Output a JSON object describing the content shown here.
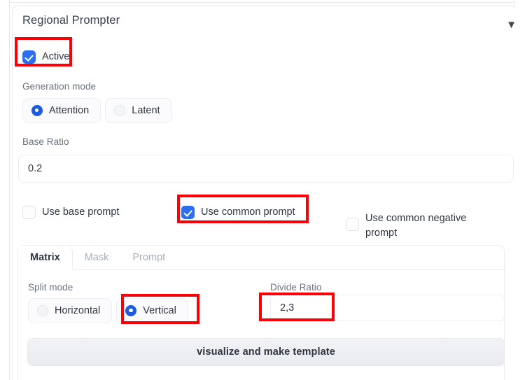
{
  "panel": {
    "title": "Regional Prompter",
    "collapse_icon": "chevron-down-icon",
    "collapse_glyph": "▼"
  },
  "active_checkbox": {
    "label": "Active",
    "checked": true
  },
  "generation_mode": {
    "label": "Generation mode",
    "options": [
      {
        "label": "Attention",
        "selected": true
      },
      {
        "label": "Latent",
        "selected": false
      }
    ]
  },
  "base_ratio": {
    "label": "Base Ratio",
    "value": "0.2",
    "placeholder": ""
  },
  "prompt_options": [
    {
      "label": "Use base prompt",
      "checked": false
    },
    {
      "label": "Use common prompt",
      "checked": true
    },
    {
      "label": "Use common negative prompt",
      "checked": false
    }
  ],
  "tabs": [
    {
      "label": "Matrix",
      "active": true
    },
    {
      "label": "Mask",
      "active": false
    },
    {
      "label": "Prompt",
      "active": false
    }
  ],
  "split_mode": {
    "label": "Split mode",
    "options": [
      {
        "label": "Horizontal",
        "selected": false
      },
      {
        "label": "Vertical",
        "selected": true
      }
    ]
  },
  "divide_ratio": {
    "label": "Divide Ratio",
    "value": "2,3",
    "placeholder": ""
  },
  "visualize_button": {
    "label": "visualize and make template"
  },
  "annotations": {
    "color": "#fb0007",
    "targets": [
      "active-checkbox",
      "use-common-prompt-checkbox",
      "vertical-radio",
      "divide-ratio-input"
    ]
  }
}
